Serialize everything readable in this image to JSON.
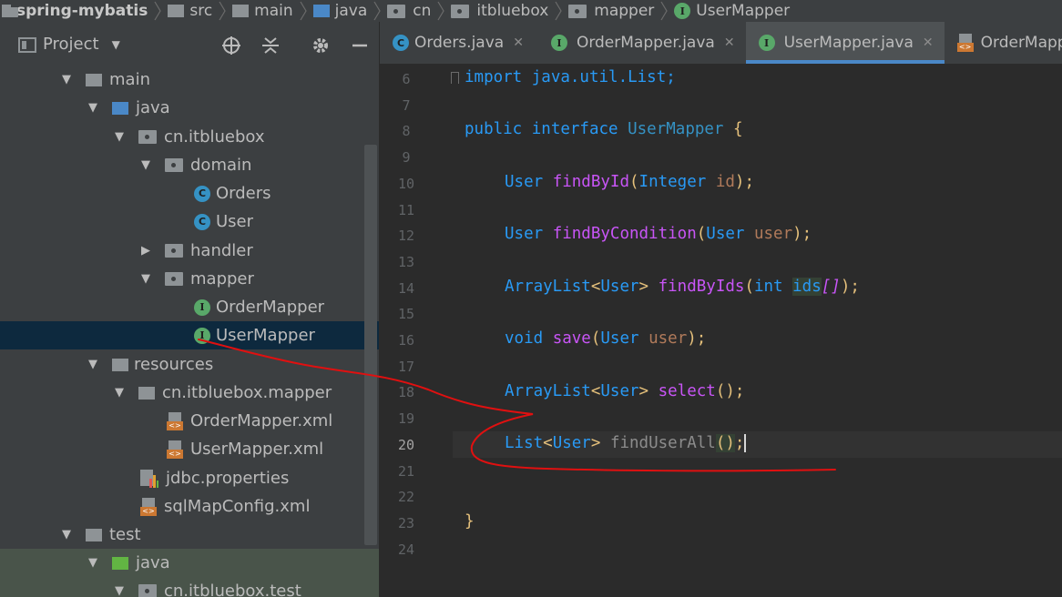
{
  "breadcrumb": [
    "spring-mybatis",
    "src",
    "main",
    "java",
    "cn",
    "itbluebox",
    "mapper",
    "UserMapper"
  ],
  "project_panel": {
    "title": "Project"
  },
  "tree": [
    {
      "label": "main",
      "icon": "folder-gray",
      "arrow": "down"
    },
    {
      "label": "java",
      "icon": "folder-blue",
      "arrow": "down"
    },
    {
      "label": "cn.itbluebox",
      "icon": "package",
      "arrow": "down"
    },
    {
      "label": "domain",
      "icon": "package",
      "arrow": "down"
    },
    {
      "label": "Orders",
      "icon": "class",
      "arrow": "none"
    },
    {
      "label": "User",
      "icon": "class",
      "arrow": "none"
    },
    {
      "label": "handler",
      "icon": "package",
      "arrow": "right"
    },
    {
      "label": "mapper",
      "icon": "package",
      "arrow": "down"
    },
    {
      "label": "OrderMapper",
      "icon": "interface",
      "arrow": "none"
    },
    {
      "label": "UserMapper",
      "icon": "interface",
      "arrow": "none",
      "selected": true
    },
    {
      "label": "resources",
      "icon": "folder-resources",
      "arrow": "down"
    },
    {
      "label": "cn.itbluebox.mapper",
      "icon": "package",
      "arrow": "down"
    },
    {
      "label": "OrderMapper.xml",
      "icon": "xml",
      "arrow": "none"
    },
    {
      "label": "UserMapper.xml",
      "icon": "xml",
      "arrow": "none"
    },
    {
      "label": "jdbc.properties",
      "icon": "properties",
      "arrow": "none"
    },
    {
      "label": "sqlMapConfig.xml",
      "icon": "xml",
      "arrow": "none"
    },
    {
      "label": "test",
      "icon": "folder-gray",
      "arrow": "down"
    },
    {
      "label": "java",
      "icon": "folder-green",
      "arrow": "down"
    },
    {
      "label": "cn.itbluebox.test",
      "icon": "package",
      "arrow": "down"
    }
  ],
  "tabs": [
    {
      "label": "Orders.java",
      "icon": "class",
      "active": false,
      "closable": true
    },
    {
      "label": "OrderMapper.java",
      "icon": "interface",
      "active": false,
      "closable": true
    },
    {
      "label": "UserMapper.java",
      "icon": "interface",
      "active": true,
      "closable": true
    },
    {
      "label": "OrderMapper.xml",
      "icon": "xml",
      "active": false,
      "closable": false
    }
  ],
  "editor": {
    "line_numbers": [
      "6",
      "7",
      "8",
      "9",
      "10",
      "11",
      "12",
      "13",
      "14",
      "15",
      "16",
      "17",
      "18",
      "19",
      "20",
      "21",
      "22",
      "23",
      "24"
    ],
    "current_line": "20",
    "code": {
      "l6": {
        "kw": "import",
        "rest": " java.util.List;"
      },
      "l8": {
        "kw": "public interface",
        "name": " UserMapper",
        "brace": " {"
      },
      "l10": {
        "type": "User",
        "method": " findById",
        "open": "(",
        "ptype": "Integer",
        "pname": " id",
        "close": ");"
      },
      "l12": {
        "type": "User",
        "method": " findByCondition",
        "open": "(",
        "ptype": "User",
        "pname": " user",
        "close": ");"
      },
      "l14": {
        "type": "ArrayList",
        "lt": "<",
        "gtype": "User",
        "gt": ">",
        "method": " findByIds",
        "open": "(",
        "ptype": "int",
        "pname": " ids",
        "arr": "[]",
        "close": ");"
      },
      "l16": {
        "type": "void",
        "method": " save",
        "open": "(",
        "ptype": "User",
        "pname": " user",
        "close": ");"
      },
      "l18": {
        "type": "ArrayList",
        "lt": "<",
        "gtype": "User",
        "gt": ">",
        "method": " select",
        "parens": "()",
        "semi": ";"
      },
      "l20": {
        "type": "List",
        "lt": "<",
        "gtype": "User",
        "gt": ">",
        "method": " findUserAll",
        "parens": "()",
        "semi": ";"
      },
      "l23": {
        "brace": "}"
      }
    }
  },
  "colors": {
    "accent": "#4a88c7",
    "annotation": "#e01010",
    "keyword": "#cc7832"
  }
}
